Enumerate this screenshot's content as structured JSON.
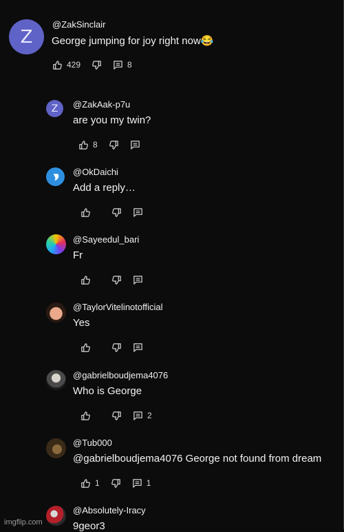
{
  "comments": [
    {
      "handle": "@ZakSinclair",
      "text": "George jumping for joy right now😂",
      "likes": "429",
      "replies": "8",
      "avatar_letter": "Z"
    },
    {
      "handle": "@ZakAak-p7u",
      "text": "are you my twin?",
      "likes": "8",
      "replies": "",
      "avatar_letter": "Z"
    },
    {
      "handle": "@OkDaichi",
      "text": "Add a reply…",
      "likes": "",
      "replies": ""
    },
    {
      "handle": "@Sayeedul_bari",
      "text": "Fr",
      "likes": "",
      "replies": ""
    },
    {
      "handle": "@TaylorVitelinotofficial",
      "text": "Yes",
      "likes": "",
      "replies": ""
    },
    {
      "handle": "@gabrielboudjema4076",
      "text": "Who is George",
      "likes": "",
      "replies": "2"
    },
    {
      "handle": "@Tub000",
      "text": "@gabrielboudjema4076 George not found from dream",
      "likes": "1",
      "replies": "1"
    },
    {
      "handle": "@Absolutely-Iracy",
      "text": "9geor3",
      "likes": "",
      "replies": ""
    }
  ],
  "watermark": "imgflip.com",
  "colors": {
    "avatar_purple": "#5f62c6",
    "background": "#0c0c0c"
  }
}
